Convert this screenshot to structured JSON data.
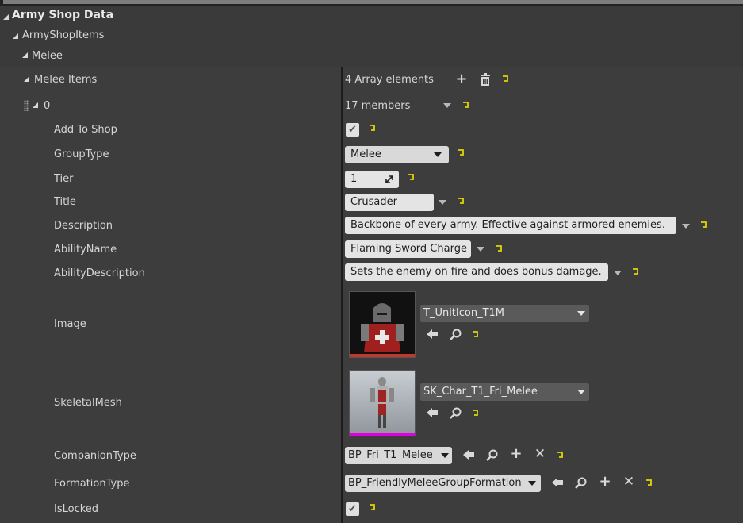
{
  "headers": {
    "army_shop_data": "Army Shop Data",
    "army_shop_items": "ArmyShopItems",
    "melee": "Melee"
  },
  "melee_items": {
    "label": "Melee Items",
    "count": "4 Array elements"
  },
  "element0": {
    "index": "0",
    "members": "17 members"
  },
  "props": {
    "add_to_shop": {
      "label": "Add To Shop",
      "checked": true
    },
    "group_type": {
      "label": "GroupType",
      "value": "Melee"
    },
    "tier": {
      "label": "Tier",
      "value": "1"
    },
    "title": {
      "label": "Title",
      "value": "Crusader"
    },
    "description": {
      "label": "Description",
      "value": "Backbone of every army. Effective against armored enemies."
    },
    "ability_name": {
      "label": "AbilityName",
      "value": "Flaming Sword Charge"
    },
    "ability_description": {
      "label": "AbilityDescription",
      "value": "Sets the enemy on fire and does bonus damage."
    },
    "image": {
      "label": "Image",
      "asset": "T_UnitIcon_T1M"
    },
    "skeletal_mesh": {
      "label": "SkeletalMesh",
      "asset": "SK_Char_T1_Fri_Melee"
    },
    "companion_type": {
      "label": "CompanionType",
      "value": "BP_Fri_T1_Melee"
    },
    "formation_type": {
      "label": "FormationType",
      "value": "BP_FriendlyMeleeGroupFormation"
    },
    "is_locked": {
      "label": "IsLocked",
      "checked": true
    }
  },
  "colors": {
    "reset_arrow": "#e0d600",
    "image_bar": "#c0392b",
    "mesh_bar": "#e000e0"
  },
  "icons": {
    "add": "plus-icon",
    "delete": "trash-icon",
    "reset": "reset-to-default-icon",
    "browse": "use-selected-arrow-icon",
    "find": "magnifier-icon",
    "clear": "x-icon",
    "checkmark": "checkmark-icon"
  }
}
